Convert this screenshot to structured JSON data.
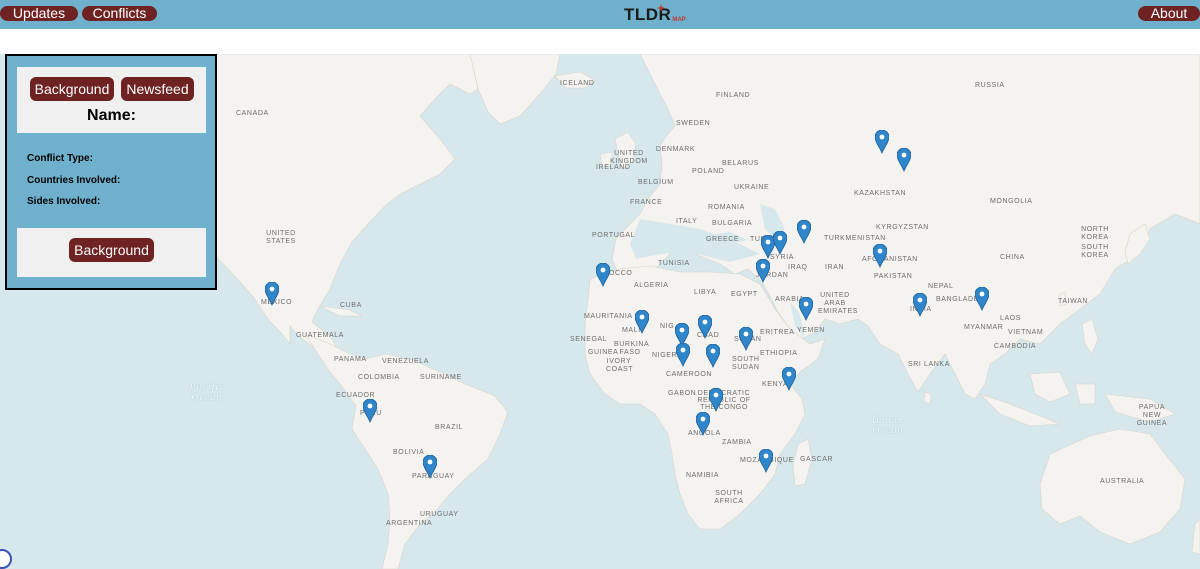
{
  "navbar": {
    "updates_label": "Updates",
    "conflicts_label": "Conflicts",
    "about_label": "About",
    "logo_text": "TLDR",
    "logo_sub": "MAP"
  },
  "panel": {
    "background_tab": "Background",
    "newsfeed_tab": "Newsfeed",
    "name_label": "Name:",
    "conflict_type_label": "Conflict Type:",
    "countries_label": "Countries Involved:",
    "sides_label": "Sides Involved:",
    "background_button": "Background"
  },
  "map": {
    "country_labels": {
      "iceland": "ICELAND",
      "finland": "FINLAND",
      "sweden": "SWEDEN",
      "russia": "RUSSIA",
      "canada": "CANADA",
      "denmark": "DENMARK",
      "united_kingdom": "UNITED KINGDOM",
      "ireland": "IRELAND",
      "belarus": "BELARUS",
      "poland": "POLAND",
      "belgium": "BELGIUM",
      "ukraine": "UKRAINE",
      "kazakhstan": "KAZAKHSTAN",
      "mongolia": "MONGOLIA",
      "france": "FRANCE",
      "romania": "ROMANIA",
      "italy": "ITALY",
      "bulgaria": "BULGARIA",
      "kyrgyzstan": "KYRGYZSTAN",
      "north_korea": "NORTH KOREA",
      "portugal": "PORTUGAL",
      "greece": "GREECE",
      "turkey": "TURK",
      "turkmenistan": "TURKMENISTAN",
      "united_states": "UNITED STATES",
      "south_korea": "SOUTH KOREA",
      "china": "CHINA",
      "syria": "SYRIA",
      "iraq": "IRAQ",
      "iran": "IRAN",
      "afghanistan": "AFGHANISTAN",
      "tunisia": "TUNISIA",
      "jordan": "JORDAN",
      "morocco": "OCCO",
      "pakistan": "PAKISTAN",
      "algeria": "ALGERIA",
      "libya": "LIBYA",
      "egypt": "EGYPT",
      "nepal": "NEPAL",
      "mexico": "MEXICO",
      "cuba": "CUBA",
      "saudi_arabia": "ARABIA",
      "uae": "UNITED ARAB EMIRATES",
      "bangladesh": "BANGLADE",
      "taiwan": "TAIWAN",
      "mauritania": "MAURITANIA",
      "india": "INDIA",
      "mali": "MALI",
      "niger": "NIG",
      "chad": "CHAD",
      "laos": "LAOS",
      "myanmar": "MYANMAR",
      "yemen": "YEMEN",
      "eritrea": "ERITREA",
      "sudan": "SUDAN",
      "vietnam": "VIETNAM",
      "guatemala": "GUATEMALA",
      "senegal": "SENEGAL",
      "burkina_faso": "BURKINA FASO",
      "guinea": "GUINEA",
      "nigeria": "NIGERIA",
      "cambodia": "CAMBODIA",
      "ethiopia": "ETHIOPIA",
      "south_sudan": "SOUTH SUDAN",
      "panama": "PANAMA",
      "venezuela": "VENEZUELA",
      "ivory_coast": "IVORY COAST",
      "sri_lanka": "SRI LANKA",
      "colombia": "COLOMBIA",
      "suriname": "SURINAME",
      "cameroon": "CAMEROON",
      "kenya": "KENYA",
      "ecuador": "ECUADOR",
      "gabon": "GABON",
      "drc": "DEMOCRATIC REPUBLIC OF THE CONGO",
      "papua_new_guinea": "PAPUA NEW GUINEA",
      "peru": "PERU",
      "brazil": "BRAZIL",
      "angola": "ANGOLA",
      "zambia": "ZAMBIA",
      "madagascar": "GASCAR",
      "bolivia": "BOLIVIA",
      "mozambique": "MOZAMBIQUE",
      "namibia": "NAMIBIA",
      "paraguay": "PARAGUAY",
      "australia": "AUSTRALIA",
      "south_africa": "SOUTH AFRICA",
      "uruguay": "URUGUAY",
      "argentina": "ARGENTINA"
    },
    "ocean_labels": {
      "pacific": "Pacific Ocean",
      "indian": "Indian Ocean"
    },
    "colors": {
      "ocean": "#d6e8ec",
      "land": "#f5f3ef",
      "marker": "#2f86cb",
      "navbar": "#6fb0cc",
      "button": "#6e2222"
    }
  }
}
